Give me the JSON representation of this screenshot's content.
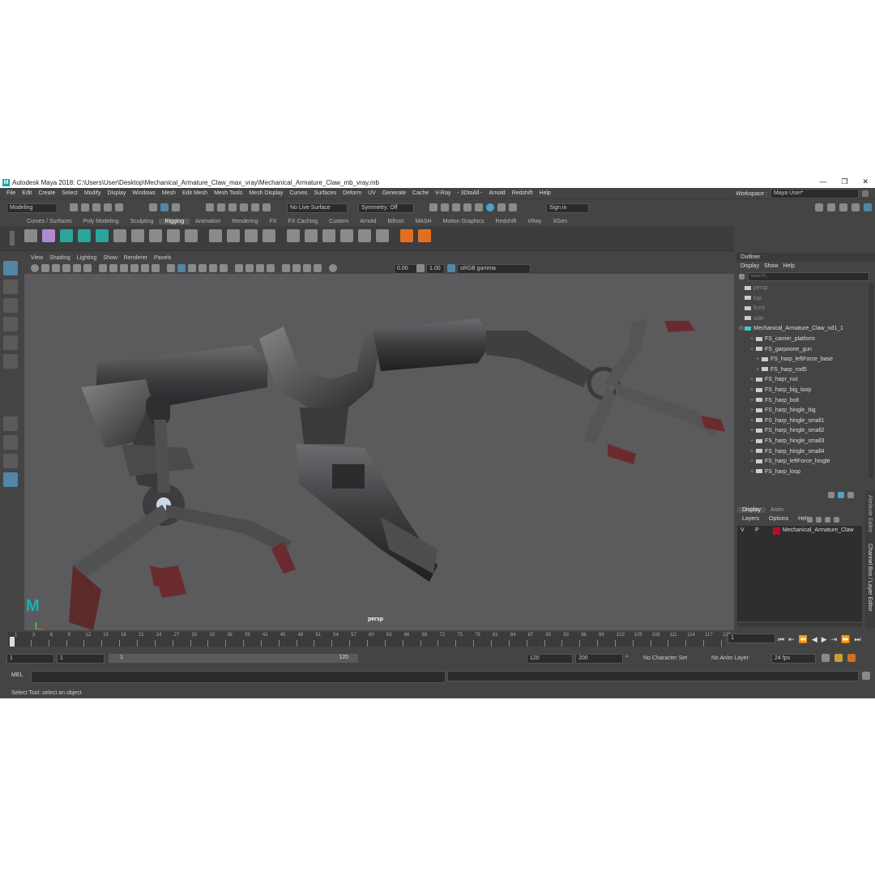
{
  "titlebar": {
    "title": "Autodesk Maya 2018: C:\\Users\\User\\Desktop\\Mechanical_Armature_Claw_max_vray\\Mechanical_Armature_Claw_mb_vray.mb",
    "minimize": "—",
    "maximize": "❐",
    "close": "✕"
  },
  "menubar": {
    "items": [
      "File",
      "Edit",
      "Create",
      "Select",
      "Modify",
      "Display",
      "Windows",
      "Mesh",
      "Edit Mesh",
      "Mesh Tools",
      "Mesh Display",
      "Curves",
      "Surfaces",
      "Deform",
      "UV",
      "Generate",
      "Cache",
      "V-Ray",
      "- 3DtoAll -",
      "Arnold",
      "Redshift",
      "Help"
    ],
    "workspace_label": "Workspace :",
    "workspace_value": "Maya User*"
  },
  "statusline": {
    "mode": "Modeling",
    "live_surface": "No Live Surface",
    "symmetry": "Symmetry: Off",
    "sign_in": "Sign in"
  },
  "shelf": {
    "tabs": [
      "Curves / Surfaces",
      "Poly Modeling",
      "Sculpting",
      "Rigging",
      "Animation",
      "Rendering",
      "FX",
      "FX Caching",
      "Custom",
      "Arnold",
      "Bifrost",
      "MASH",
      "Motion Graphics",
      "Redshift",
      "VRay",
      "XGen"
    ],
    "active_tab": "Rigging"
  },
  "viewport": {
    "menu": [
      "View",
      "Shading",
      "Lighting",
      "Show",
      "Renderer",
      "Panels"
    ],
    "exposure": "0.00",
    "gamma": "1.00",
    "color_space": "sRGB gamma",
    "camera_label": "persp"
  },
  "outliner": {
    "title": "Outliner",
    "menu": [
      "Display",
      "Show",
      "Help"
    ],
    "search_placeholder": "Search...",
    "items": [
      {
        "label": "persp",
        "dim": true,
        "indent": 1
      },
      {
        "label": "top",
        "dim": true,
        "indent": 1
      },
      {
        "label": "front",
        "dim": true,
        "indent": 1
      },
      {
        "label": "side",
        "dim": true,
        "indent": 1
      },
      {
        "label": "Mechanical_Armature_Claw_nd1_1",
        "dim": false,
        "indent": 0
      },
      {
        "label": "FS_carrier_platform",
        "dim": false,
        "indent": 2
      },
      {
        "label": "FS_garpoone_gun",
        "dim": false,
        "indent": 2
      },
      {
        "label": "FS_harp_leftForce_base",
        "dim": false,
        "indent": 3
      },
      {
        "label": "FS_harp_rod5",
        "dim": false,
        "indent": 3
      },
      {
        "label": "FS_hapr_nut",
        "dim": false,
        "indent": 2
      },
      {
        "label": "FS_harp_big_loop",
        "dim": false,
        "indent": 2
      },
      {
        "label": "FS_harp_bolt",
        "dim": false,
        "indent": 2
      },
      {
        "label": "FS_harp_hingle_big",
        "dim": false,
        "indent": 2
      },
      {
        "label": "FS_harp_hingle_small1",
        "dim": false,
        "indent": 2
      },
      {
        "label": "FS_harp_hingle_small2",
        "dim": false,
        "indent": 2
      },
      {
        "label": "FS_harp_hingle_small3",
        "dim": false,
        "indent": 2
      },
      {
        "label": "FS_harp_hingle_small4",
        "dim": false,
        "indent": 2
      },
      {
        "label": "FS_harp_leftForce_hingle",
        "dim": false,
        "indent": 2
      },
      {
        "label": "FS_harp_loop",
        "dim": false,
        "indent": 2
      }
    ]
  },
  "channel_box": {
    "tabs": [
      "Display",
      "Anim"
    ],
    "menu": [
      "Layers",
      "Options",
      "Help"
    ],
    "layer": {
      "v": "V",
      "p": "P",
      "name": "Mechanical_Armature_Claw",
      "color": "#b01030"
    },
    "side_tabs": [
      "Attribute Editor",
      "Channel Box / Layer Editor"
    ]
  },
  "timeline": {
    "ticks": [
      "1",
      "3",
      "6",
      "9",
      "12",
      "15",
      "18",
      "21",
      "24",
      "27",
      "30",
      "33",
      "36",
      "39",
      "42",
      "45",
      "48",
      "51",
      "54",
      "57",
      "60",
      "63",
      "66",
      "69",
      "72",
      "75",
      "78",
      "81",
      "84",
      "87",
      "90",
      "93",
      "96",
      "99",
      "102",
      "105",
      "108",
      "111",
      "114",
      "117",
      "120"
    ],
    "current_frame": "1"
  },
  "range": {
    "start": "1",
    "playback_start": "1",
    "slider_start": "1",
    "slider_end": "120",
    "playback_end": "120",
    "end": "200",
    "character_set": "No Character Set",
    "anim_layer": "No Anim Layer",
    "fps": "24 fps"
  },
  "command": {
    "mel_label": "MEL"
  },
  "help_line": "Select Tool: select an object"
}
